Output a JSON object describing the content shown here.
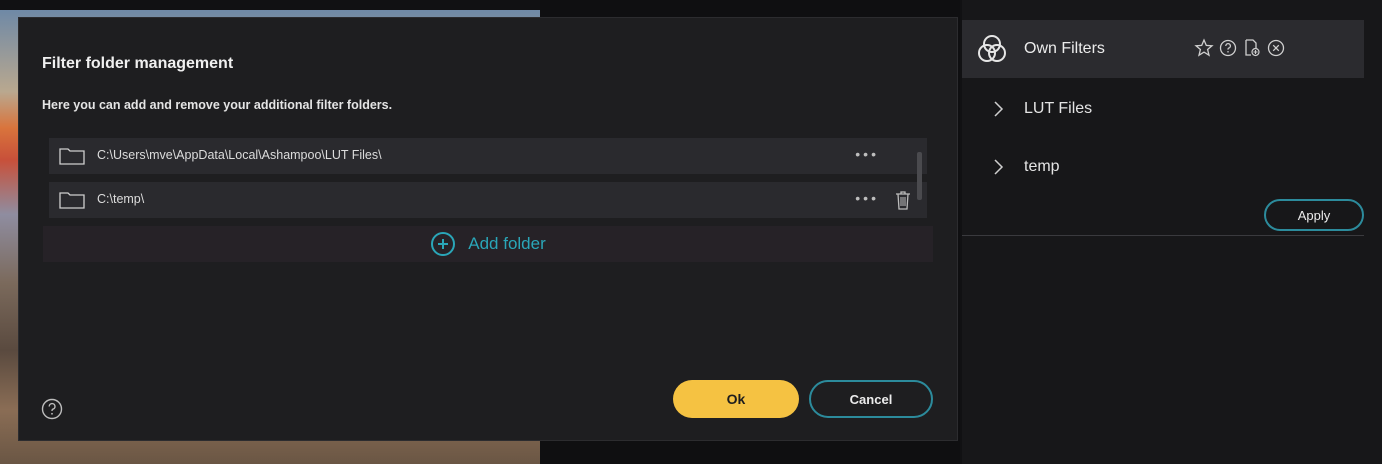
{
  "dialog": {
    "title": "Filter folder management",
    "description": "Here you can add and remove your additional filter folders.",
    "folders": [
      {
        "path": "C:\\Users\\mve\\AppData\\Local\\Ashampoo\\LUT Files\\",
        "menu": "•••"
      },
      {
        "path": "C:\\temp\\",
        "menu": "•••"
      }
    ],
    "add_folder_label": "Add folder",
    "ok_label": "Ok",
    "cancel_label": "Cancel"
  },
  "panel": {
    "title": "Own Filters",
    "items": [
      {
        "label": "LUT Files"
      },
      {
        "label": "temp"
      }
    ],
    "apply_label": "Apply"
  },
  "colors": {
    "accent": "#2aa6b8",
    "ok_button": "#f5c242",
    "dialog_bg": "#1e1e20"
  }
}
